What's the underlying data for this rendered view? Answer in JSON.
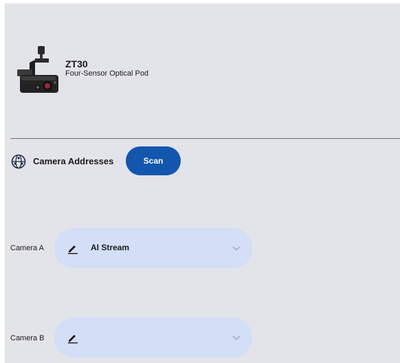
{
  "device": {
    "name": "ZT30",
    "subtitle": "Four-Sensor Optical Pod"
  },
  "camera_addresses": {
    "title": "Camera Addresses",
    "scan_label": "Scan",
    "icon": "network-globe-icon"
  },
  "cameras": [
    {
      "label": "Camera A",
      "value": "AI Stream",
      "icon": "edit-pencil-icon"
    },
    {
      "label": "Camera B",
      "value": "",
      "icon": "edit-pencil-icon"
    }
  ],
  "colors": {
    "background": "#e3e3ea",
    "accent": "#1356ad",
    "field": "#d3def7"
  }
}
